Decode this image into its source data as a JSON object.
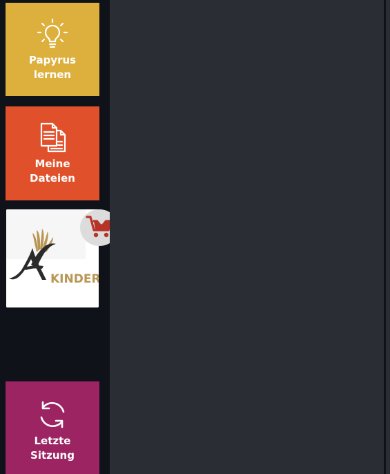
{
  "sidebar": {
    "tiles": [
      {
        "label": "Papyrus\nlernen",
        "icon": "lightbulb-icon",
        "color": "#ddaf3c"
      },
      {
        "label": "Meine\nDateien",
        "icon": "files-icon",
        "color": "#e0512b"
      },
      {
        "label": "Letzte\nSitzung",
        "icon": "refresh-icon",
        "color": "#9c2463"
      }
    ],
    "ad": {
      "logo_text": "KINDER",
      "cart_icon": "cart-icon",
      "cart_color": "#b73328"
    }
  },
  "colors": {
    "background": "#0f1219",
    "main_panel": "#2a2d34",
    "logo_gold": "#b99654",
    "logo_dark": "#2b2b2b"
  }
}
